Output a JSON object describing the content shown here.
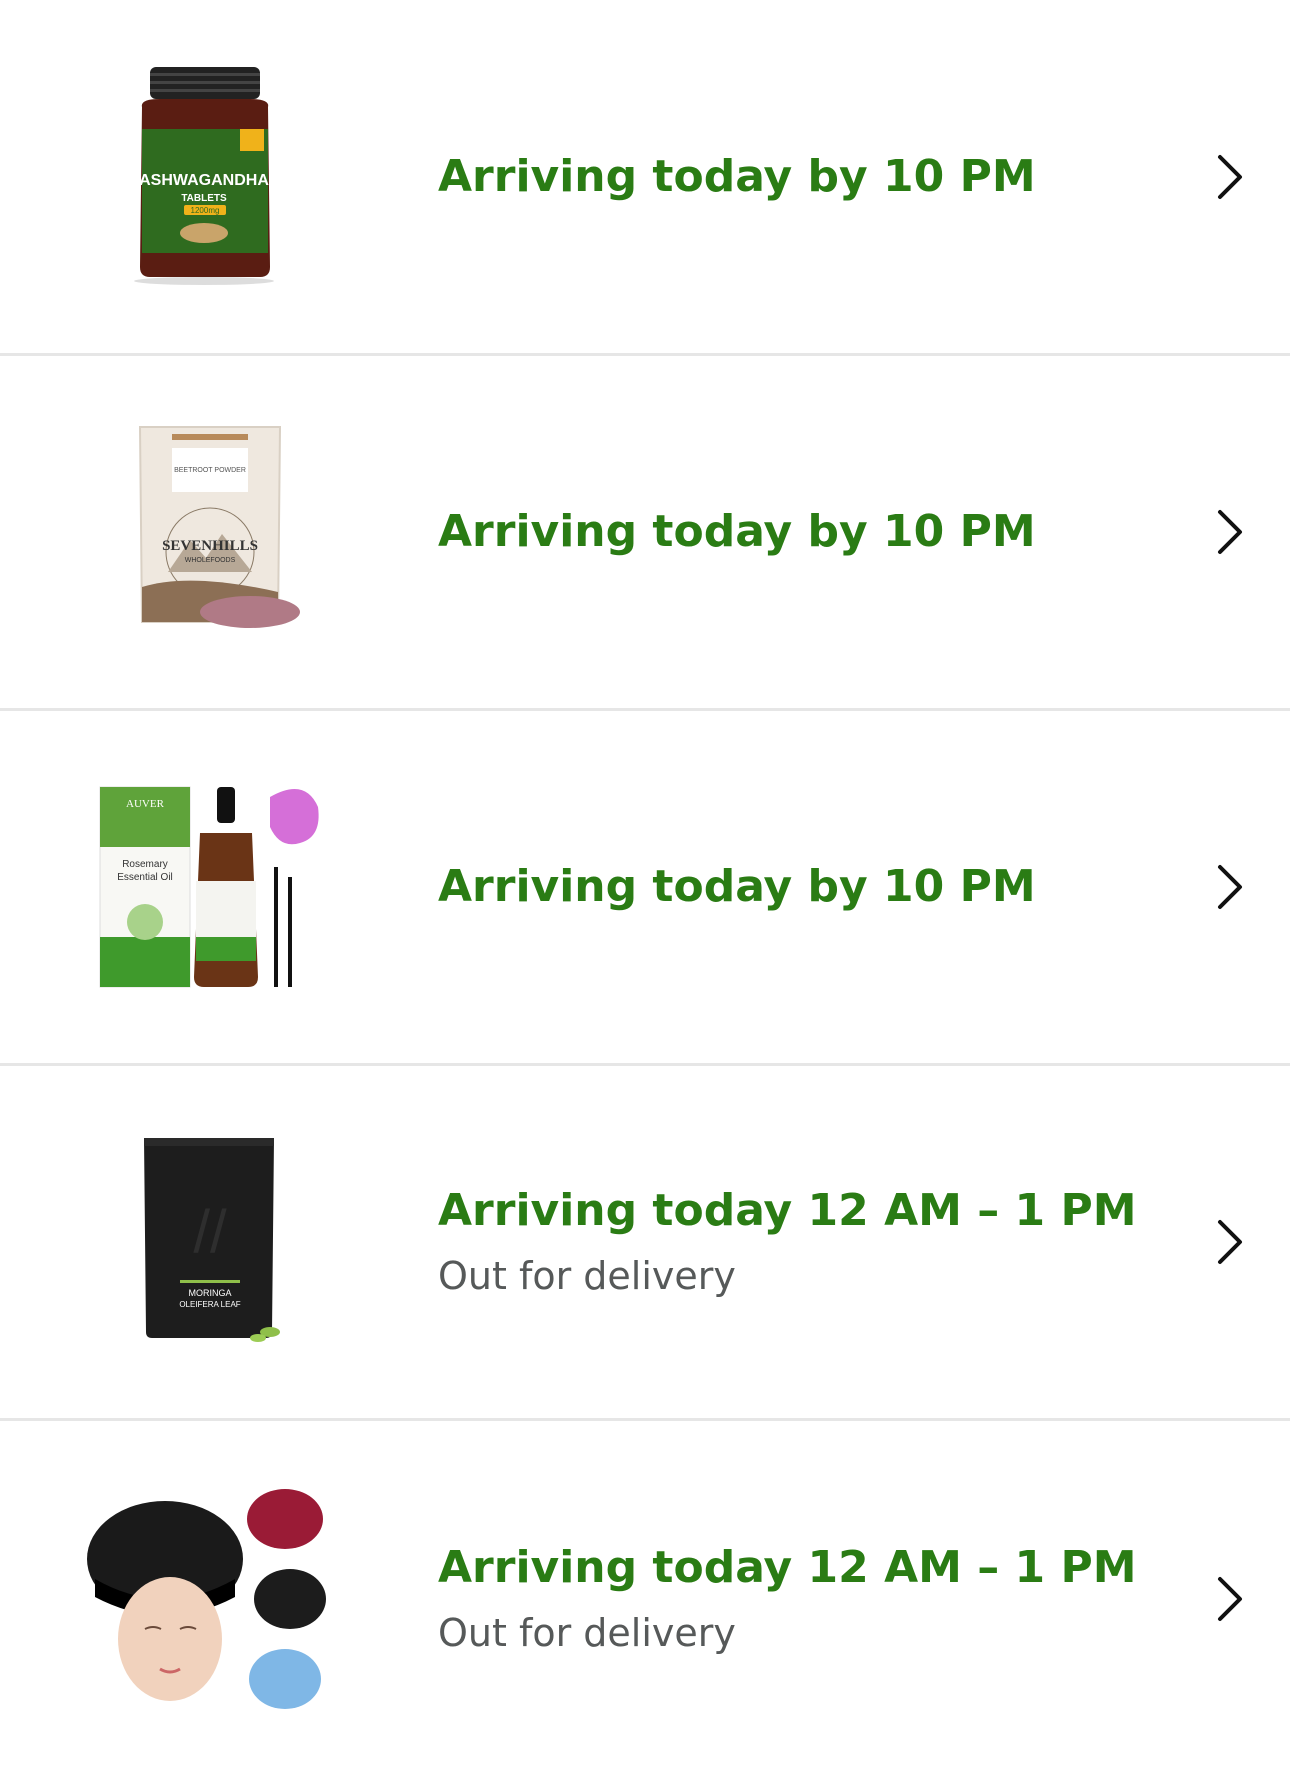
{
  "colors": {
    "status_green": "#2a7c14",
    "subtext_gray": "#565959",
    "divider": "#e6e6e6"
  },
  "deliveries": [
    {
      "status": "Arriving today by 10 PM",
      "substatus": "",
      "product_image_text": {
        "brand": "ASHWAGANDHA",
        "line2": "TABLETS",
        "dose": "1200mg"
      }
    },
    {
      "status": "Arriving today by 10 PM",
      "substatus": "",
      "product_image_text": {
        "brand": "SEVENHILLS",
        "line2": "WHOLEFOODS",
        "top": "BEETROOT POWDER"
      }
    },
    {
      "status": "Arriving today by 10 PM",
      "substatus": "",
      "product_image_text": {
        "brand": "AUVER",
        "line2": "Rosemary",
        "line3": "Essential Oil"
      }
    },
    {
      "status": "Arriving today 12 AM – 1 PM",
      "substatus": "Out for delivery",
      "product_image_text": {
        "brand": "MORINGA",
        "line2": "OLEIFERA LEAF"
      }
    },
    {
      "status": "Arriving today 12 AM – 1 PM",
      "substatus": "Out for delivery",
      "product_image_text": {}
    }
  ],
  "icons": {
    "row_action": "chevron-right-icon"
  }
}
